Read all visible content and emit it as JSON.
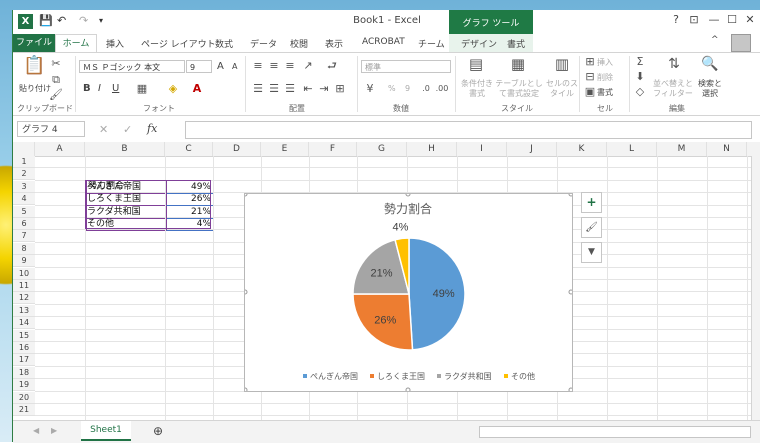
{
  "window": {
    "title": "Book1 - Excel",
    "chart_tools_label": "グラフ ツール",
    "help": "?",
    "restore_ribbon": "⊡",
    "minimize": "—",
    "maximize": "☐",
    "close": "✕"
  },
  "tabs": {
    "file": "ファイル",
    "items": [
      "ホーム",
      "挿入",
      "ページ レイアウト",
      "数式",
      "データ",
      "校閲",
      "表示",
      "ACROBAT",
      "チーム",
      "デザイン",
      "書式"
    ],
    "collapse": "^"
  },
  "ribbon": {
    "clipboard": {
      "paste": "貼り付け",
      "group": "クリップボード"
    },
    "font": {
      "name": "ＭＳ Ｐゴシック 本文",
      "size": "9",
      "bold": "B",
      "italic": "I",
      "underline": "U",
      "grow": "A",
      "shrink": "A",
      "group": "フォント"
    },
    "alignment": {
      "group": "配置"
    },
    "number": {
      "format": "標準",
      "percent": "%",
      "comma": "9",
      "group": "数値"
    },
    "styles": {
      "conditional": "条件付き書式",
      "table": "テーブルとして書式設定",
      "cell_styles": "セルのスタイル",
      "group": "スタイル"
    },
    "cells": {
      "insert": "挿入",
      "delete": "削除",
      "format": "書式",
      "group": "セル"
    },
    "editing": {
      "sort": "並べ替えと フィルター",
      "find": "検索と 選択",
      "group": "編集"
    }
  },
  "formula_bar": {
    "name_box": "グラフ 4",
    "fx": "fx",
    "cancel": "✕",
    "enter": "✓",
    "formula": ""
  },
  "columns": [
    "A",
    "B",
    "C",
    "D",
    "E",
    "F",
    "G",
    "H",
    "I",
    "J",
    "K",
    "L",
    "M",
    "N"
  ],
  "rows": [
    "1",
    "2",
    "3",
    "4",
    "5",
    "6",
    "7",
    "8",
    "9",
    "10",
    "11",
    "12",
    "13",
    "14",
    "15",
    "16",
    "17",
    "18",
    "19",
    "20",
    "21"
  ],
  "cells": {
    "B2": "勢力割合",
    "table": [
      {
        "name": "ぺんぎん帝国",
        "value": "49%"
      },
      {
        "name": "しろくま王国",
        "value": "26%"
      },
      {
        "name": "ラクダ共和国",
        "value": "21%"
      },
      {
        "name": "その他",
        "value": "4%"
      }
    ]
  },
  "chart_buttons": {
    "add": "+",
    "style": "🖌",
    "filter": "▼"
  },
  "chart_data": {
    "type": "pie",
    "title": "勢力割合",
    "categories": [
      "ぺんぎん帝国",
      "しろくま王国",
      "ラクダ共和国",
      "その他"
    ],
    "values": [
      49,
      26,
      21,
      4
    ],
    "labels": [
      "49%",
      "26%",
      "21%",
      "4%"
    ],
    "colors": [
      "#5b9bd5",
      "#ed7d31",
      "#a5a5a5",
      "#ffc000"
    ],
    "legend": "bottom"
  },
  "sheets": {
    "active": "Sheet1",
    "add": "⊕"
  }
}
